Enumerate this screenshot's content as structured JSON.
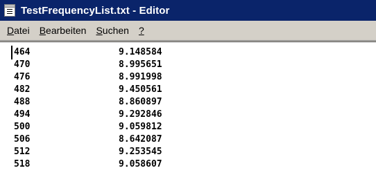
{
  "window": {
    "title": "TestFrequencyList.txt - Editor",
    "icon": "notepad-document-icon"
  },
  "menu": {
    "items": [
      {
        "accel": "D",
        "rest": "atei"
      },
      {
        "accel": "B",
        "rest": "earbeiten"
      },
      {
        "accel": "S",
        "rest": "uchen"
      },
      {
        "accel": "?",
        "rest": ""
      }
    ]
  },
  "editor": {
    "rows": [
      {
        "freq": "464",
        "value": "9.148584"
      },
      {
        "freq": "470",
        "value": "8.995651"
      },
      {
        "freq": "476",
        "value": "8.991998"
      },
      {
        "freq": "482",
        "value": "9.450561"
      },
      {
        "freq": "488",
        "value": "8.860897"
      },
      {
        "freq": "494",
        "value": "9.292846"
      },
      {
        "freq": "500",
        "value": "9.059812"
      },
      {
        "freq": "506",
        "value": "8.642087"
      },
      {
        "freq": "512",
        "value": "9.253545"
      },
      {
        "freq": "518",
        "value": "9.058607"
      }
    ]
  },
  "colors": {
    "titlebar": "#0a246a",
    "chrome": "#d4d0c8",
    "editor_bg": "#ffffff"
  }
}
